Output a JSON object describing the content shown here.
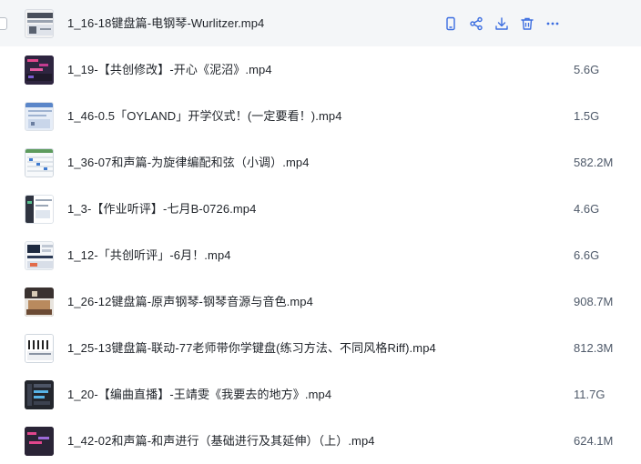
{
  "files": [
    {
      "name": "1_16-18键盘篇-电钢琴-Wurlitzer.mp4",
      "size": "",
      "hover": true
    },
    {
      "name": "1_19-【共创修改】-开心《泥沼》.mp4",
      "size": "5.6G"
    },
    {
      "name": "1_46-0.5「OYLAND」开学仪式！(一定要看！).mp4",
      "size": "1.5G"
    },
    {
      "name": "1_36-07和声篇-为旋律编配和弦（小调）.mp4",
      "size": "582.2M"
    },
    {
      "name": "1_3-【作业听评】-七月B-0726.mp4",
      "size": "4.6G"
    },
    {
      "name": "1_12-「共创听评」-6月！.mp4",
      "size": "6.6G"
    },
    {
      "name": "1_26-12键盘篇-原声钢琴-钢琴音源与音色.mp4",
      "size": "908.7M"
    },
    {
      "name": "1_25-13键盘篇-联动-77老师带你学键盘(练习方法、不同风格Riff).mp4",
      "size": "812.3M"
    },
    {
      "name": "1_20-【编曲直播】-王靖雯《我要去的地方》.mp4",
      "size": "11.7G"
    },
    {
      "name": "1_42-02和声篇-和声进行（基础进行及其延伸）（上）.mp4",
      "size": "624.1M"
    }
  ],
  "icons": {
    "actions": [
      "phone-icon",
      "share-icon",
      "download-icon",
      "delete-icon",
      "more-icon"
    ],
    "accent": "#3b6de0"
  }
}
